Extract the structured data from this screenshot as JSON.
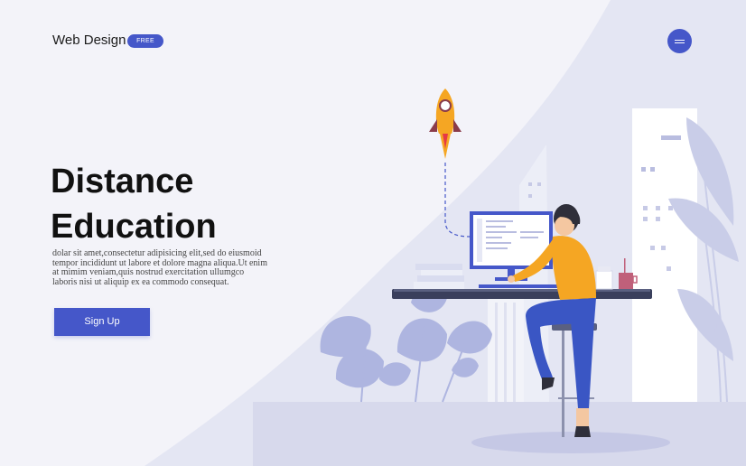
{
  "header": {
    "brand": "Web Design",
    "badge": "FREE",
    "menu_icon": "hamburger-icon"
  },
  "hero": {
    "title_line1": "Distance",
    "title_line2": "Education",
    "description": "dolar sit amet,consectetur adipisicing elit,sed do eiusmoid tempor incididunt ut labore et dolore magna aliqua.Ut enim at mimim veniam,quis nostrud exercitation ullumgco laboris nisi ut aliquip ex ea commodo consequat.",
    "cta_label": "Sign Up"
  },
  "illustration": {
    "icons": [
      "rocket-icon",
      "computer-monitor-icon",
      "books-icon",
      "coffee-cup-icon",
      "person-icon",
      "plant-leaf-icon",
      "building-icon"
    ]
  },
  "colors": {
    "accent": "#4557c9",
    "shirt": "#f5a623",
    "pants": "#3a56c4",
    "background": "#f3f3f9"
  }
}
